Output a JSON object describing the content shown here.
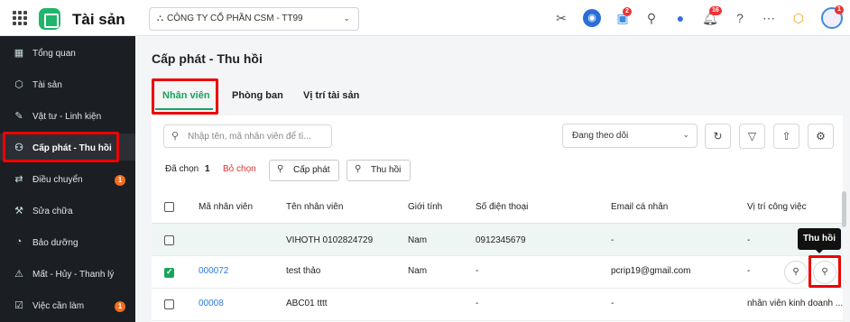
{
  "app": {
    "title": "Tài sản"
  },
  "company": {
    "name": "CÔNG TY CỔ PHẦN CSM - TT99"
  },
  "topbar": {
    "cart_badge": "2",
    "bell_badge": "16",
    "avatar_badge": "1"
  },
  "sidebar": {
    "items": [
      {
        "label": "Tổng quan",
        "icon": "grid-icon"
      },
      {
        "label": "Tài sản",
        "icon": "box-icon"
      },
      {
        "label": "Vật tư - Linh kiện",
        "icon": "wrench-icon"
      },
      {
        "label": "Cấp phát - Thu hồi",
        "icon": "user-transfer-icon"
      },
      {
        "label": "Điều chuyển",
        "icon": "swap-icon",
        "badge": "1"
      },
      {
        "label": "Sửa chữa",
        "icon": "hammer-icon"
      },
      {
        "label": "Bảo dưỡng",
        "icon": "gauge-icon"
      },
      {
        "label": "Mất - Hủy - Thanh lý",
        "icon": "warning-icon"
      },
      {
        "label": "Việc cần làm",
        "icon": "checklist-icon",
        "badge": "1"
      }
    ]
  },
  "page": {
    "title": "Cấp phát - Thu hồi"
  },
  "tabs": [
    "Nhân viên",
    "Phòng ban",
    "Vị trí tài sản"
  ],
  "toolbar": {
    "search_placeholder": "Nhập tên, mã nhân viên để tì...",
    "filter_select": "Đang theo dõi"
  },
  "selection": {
    "label": "Đã chọn",
    "count": "1",
    "clear": "Bỏ chọn",
    "allocate": "Cấp phát",
    "recall": "Thu hồi"
  },
  "table": {
    "headers": [
      "Mã nhân viên",
      "Tên nhân viên",
      "Giới tính",
      "Số điện thoại",
      "Email cá nhân",
      "Vị trí công việc"
    ],
    "rows": [
      {
        "code": "",
        "name": "VIHOTH 0102824729",
        "gender": "Nam",
        "phone": "0912345679",
        "email": "-",
        "position": "-",
        "checked": false
      },
      {
        "code": "000072",
        "name": "test thảo",
        "gender": "Nam",
        "phone": "-",
        "email": "pcrip19@gmail.com",
        "position": "-",
        "checked": true
      },
      {
        "code": "00008",
        "name": "ABC01 tttt",
        "gender": "",
        "phone": "-",
        "email": "-",
        "position": "nhân viên kinh doanh ...",
        "checked": false
      }
    ]
  },
  "tooltip": "Thu hồi"
}
